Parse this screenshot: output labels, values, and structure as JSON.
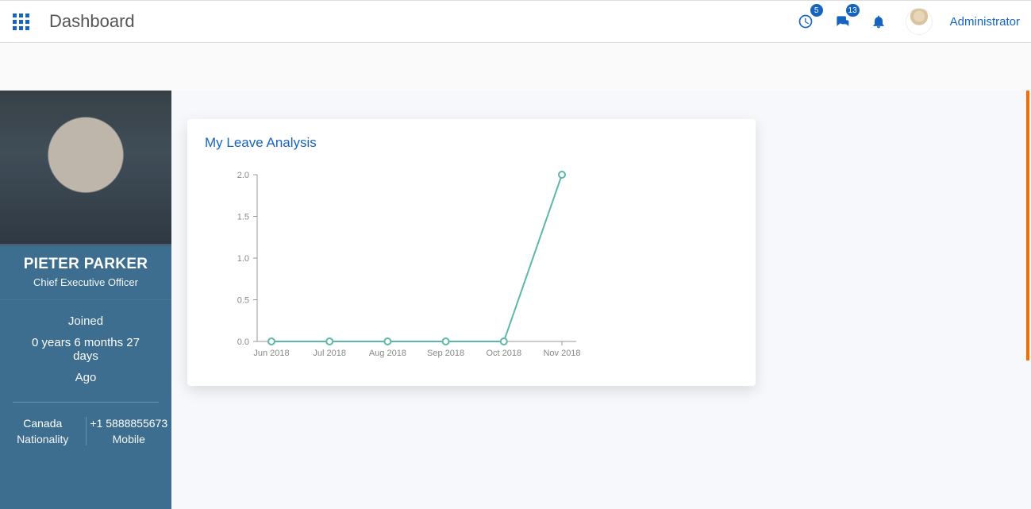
{
  "header": {
    "title": "Dashboard",
    "clock_badge": "5",
    "chat_badge": "13",
    "user": "Administrator"
  },
  "profile": {
    "name": "PIETER PARKER",
    "role": "Chief Executive Officer",
    "joined_label": "Joined",
    "joined_duration": "0 years 6 months 27 days",
    "joined_ago": "Ago",
    "nationality_value": "Canada",
    "nationality_label": "Nationality",
    "mobile_value": "+1 5888855673",
    "mobile_label": "Mobile"
  },
  "card": {
    "title": "My Leave Analysis"
  },
  "chart_data": {
    "type": "line",
    "title": "My Leave Analysis",
    "xlabel": "",
    "ylabel": "",
    "ylim": [
      0,
      2
    ],
    "yticks": [
      0.0,
      0.5,
      1.0,
      1.5,
      2.0
    ],
    "categories": [
      "Jun 2018",
      "Jul 2018",
      "Aug 2018",
      "Sep 2018",
      "Oct 2018",
      "Nov 2018"
    ],
    "values": [
      0,
      0,
      0,
      0,
      0,
      2
    ]
  }
}
